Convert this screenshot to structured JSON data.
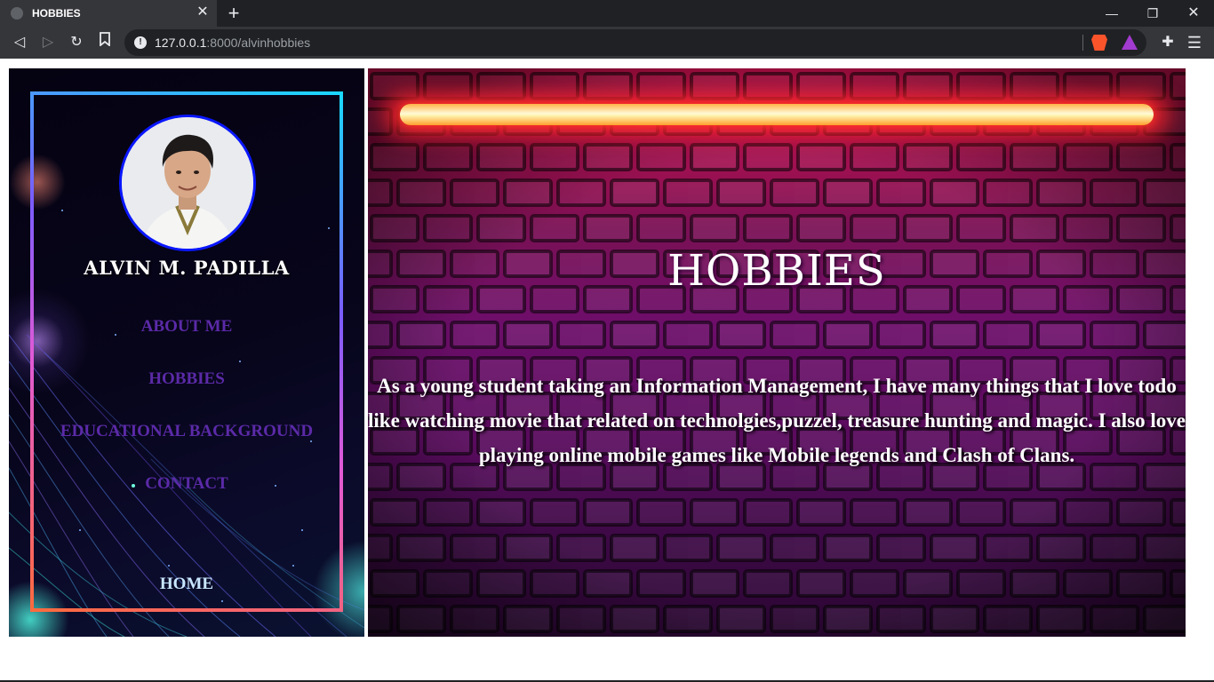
{
  "browser": {
    "tab_title": "HOBBIES",
    "url_host": "127.0.0.1",
    "url_path": ":8000/alvinhobbies"
  },
  "sidebar": {
    "name": "ALVIN M. PADILLA",
    "nav": {
      "about": "ABOUT ME",
      "hobbies": "HOBBIES",
      "education": "EDUCATIONAL BACKGROUND",
      "contact": "CONTACT",
      "home": "HOME"
    }
  },
  "main": {
    "title": "HOBBIES",
    "paragraph": "As a young student taking an Information Management, I have many things that I love todo like watching movie that related on technolgies,puzzel, treasure hunting and magic. I also love playing online mobile games like Mobile legends and Clash of Clans."
  },
  "colors": {
    "frame_gradient": [
      "#ff6a3d",
      "#e15ad6",
      "#7a5cff",
      "#1ad8ff"
    ],
    "nav_link": "#5b2aa8",
    "home_link": "#c9e6ff",
    "hero_top": "#e31459",
    "hero_bottom": "#2a0632"
  },
  "icons": [
    "page-favicon-icon",
    "close-tab-icon",
    "new-tab-icon",
    "minimize-icon",
    "maximize-icon",
    "close-window-icon",
    "back-icon",
    "forward-icon",
    "reload-icon",
    "bookmark-icon",
    "site-info-icon",
    "brave-shields-icon",
    "brave-rewards-icon",
    "extensions-icon",
    "menu-icon"
  ]
}
